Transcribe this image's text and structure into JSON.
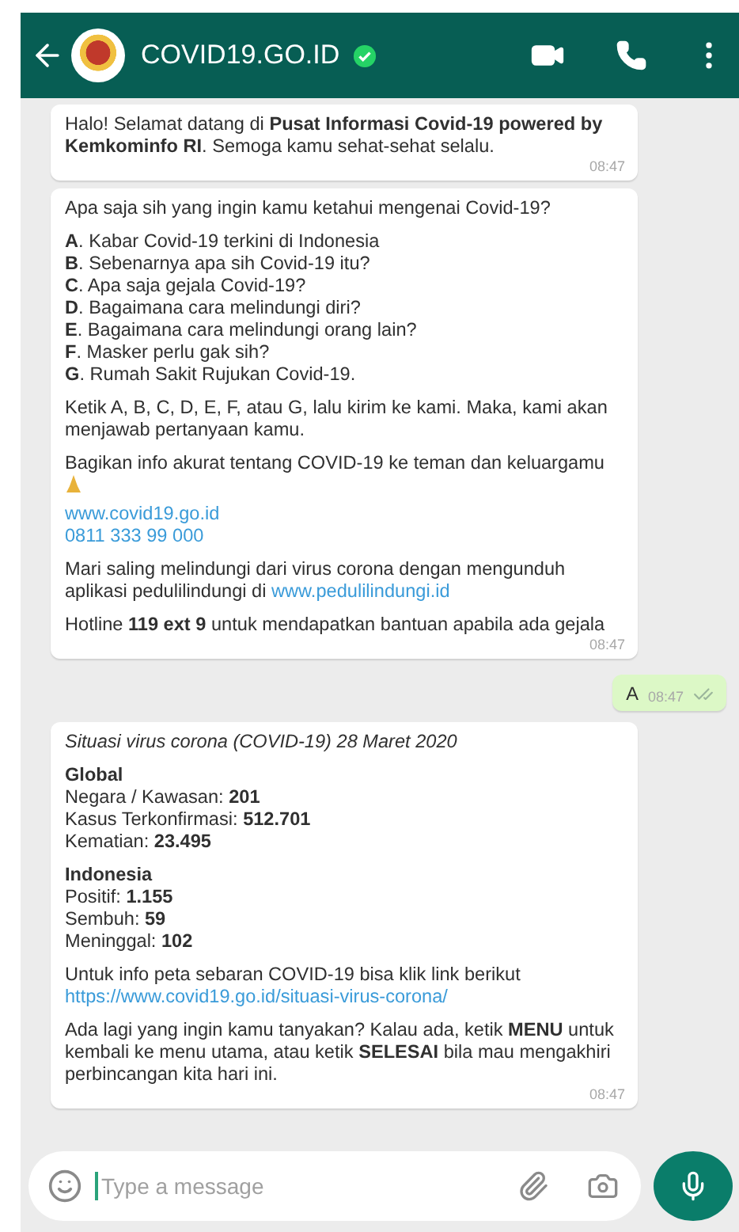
{
  "header": {
    "title": "COVID19.GO.ID",
    "verified": true
  },
  "messages": [
    {
      "kind": "incoming",
      "time": "08:47",
      "paragraphs": [
        {
          "lines": [
            {
              "kind": "text",
              "text": "Halo! Selamat datang di **Pusat Informasi Covid-19 powered by Kemkominfo RI**. Semoga kamu sehat-sehat selalu."
            }
          ]
        }
      ]
    },
    {
      "kind": "incoming",
      "time": "08:47",
      "paragraphs": [
        {
          "lines": [
            {
              "kind": "text",
              "text": "Apa saja sih yang ingin kamu ketahui mengenai Covid-19?"
            }
          ]
        },
        {
          "lines": [
            {
              "kind": "text",
              "text": "**A**. Kabar Covid-19 terkini di Indonesia"
            },
            {
              "kind": "text",
              "text": "**B**. Sebenarnya apa sih Covid-19 itu?"
            },
            {
              "kind": "text",
              "text": "**C**. Apa saja gejala Covid-19?"
            },
            {
              "kind": "text",
              "text": "**D**. Bagaimana cara melindungi diri?"
            },
            {
              "kind": "text",
              "text": "**E**. Bagaimana cara melindungi orang lain?"
            },
            {
              "kind": "text",
              "text": "**F**. Masker perlu gak sih?"
            },
            {
              "kind": "text",
              "text": "**G**. Rumah Sakit Rujukan Covid-19."
            }
          ]
        },
        {
          "lines": [
            {
              "kind": "text",
              "text": "Ketik A, B, C, D, E, F, atau G, lalu kirim ke kami. Maka, kami akan menjawab pertanyaan kamu."
            }
          ]
        },
        {
          "lines": [
            {
              "kind": "text",
              "text": "Bagikan info akurat tentang COVID-19 ke teman dan keluargamu"
            },
            {
              "kind": "emoji"
            },
            {
              "kind": "link",
              "text": "www.covid19.go.id"
            },
            {
              "kind": "link",
              "text": "0811 333 99 000"
            }
          ]
        },
        {
          "lines": [
            {
              "kind": "mixed",
              "text": "Mari saling melindungi dari virus corona dengan mengunduh aplikasi pedulilindungi di ",
              "link": "www.pedulilindungi.id"
            }
          ]
        },
        {
          "lines": [
            {
              "kind": "text",
              "text": "Hotline **119 ext 9** untuk mendapatkan bantuan apabila ada gejala"
            }
          ]
        }
      ]
    },
    {
      "kind": "outgoing",
      "time": "08:47",
      "paragraphs": [
        {
          "lines": [
            {
              "kind": "text",
              "text": "A"
            }
          ]
        }
      ]
    },
    {
      "kind": "incoming",
      "time": "08:47",
      "paragraphs": [
        {
          "lines": [
            {
              "kind": "italic",
              "text": "Situasi virus corona (COVID-19) 28 Maret 2020"
            }
          ]
        },
        {
          "lines": [
            {
              "kind": "heading",
              "text": "Global"
            },
            {
              "kind": "text",
              "text": "Negara / Kawasan: **201**"
            },
            {
              "kind": "text",
              "text": "Kasus Terkonfirmasi: **512.701**"
            },
            {
              "kind": "text",
              "text": "Kematian: **23.495**"
            }
          ]
        },
        {
          "lines": [
            {
              "kind": "heading",
              "text": "Indonesia"
            },
            {
              "kind": "text",
              "text": "Positif: **1.155**"
            },
            {
              "kind": "text",
              "text": "Sembuh: **59**"
            },
            {
              "kind": "text",
              "text": "Meninggal: **102**"
            }
          ]
        },
        {
          "lines": [
            {
              "kind": "text",
              "text": "Untuk info peta sebaran COVID-19 bisa klik link berikut"
            },
            {
              "kind": "link",
              "text": "https://www.covid19.go.id/situasi-virus-corona/"
            }
          ]
        },
        {
          "lines": [
            {
              "kind": "text",
              "text": "Ada lagi yang ingin kamu tanyakan? Kalau ada, ketik **MENU** untuk kembali ke menu utama, atau ketik **SELESAI** bila mau mengakhiri perbincangan kita hari ini."
            }
          ]
        }
      ]
    }
  ],
  "composer": {
    "placeholder": "Type a message"
  }
}
